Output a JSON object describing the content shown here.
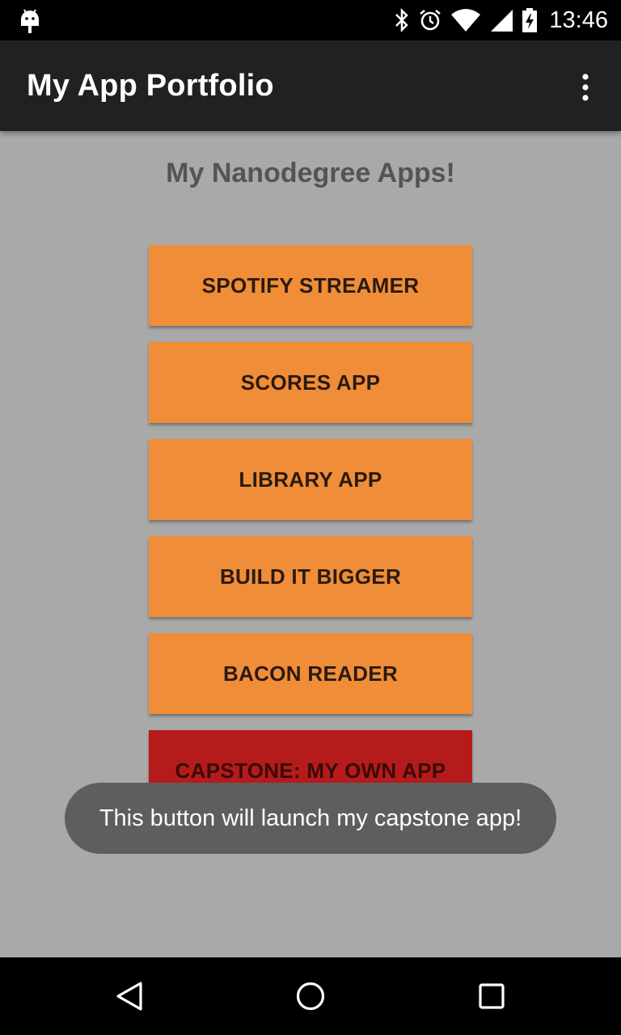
{
  "status_bar": {
    "time": "13:46",
    "icons": [
      "android-icon",
      "bluetooth-icon",
      "alarm-icon",
      "wifi-icon",
      "signal-icon",
      "battery-charging-icon"
    ]
  },
  "app_bar": {
    "title": "My App Portfolio",
    "menu_icon": "overflow-menu-icon"
  },
  "main": {
    "heading": "My Nanodegree Apps!",
    "buttons": [
      {
        "label": "SPOTIFY STREAMER"
      },
      {
        "label": "SCORES APP"
      },
      {
        "label": "LIBRARY APP"
      },
      {
        "label": "BUILD IT BIGGER"
      },
      {
        "label": "BACON READER"
      },
      {
        "label": "CAPSTONE: MY OWN APP"
      }
    ]
  },
  "toast": {
    "message": "This button will launch my capstone app!"
  },
  "nav_bar": {
    "icons": [
      "back-icon",
      "home-icon",
      "recents-icon"
    ]
  },
  "colors": {
    "background": "#a9a9a9",
    "app_bar": "#212121",
    "button": "#f08d38",
    "capstone_button": "#b51b1b",
    "toast": "#5e5e5e"
  }
}
